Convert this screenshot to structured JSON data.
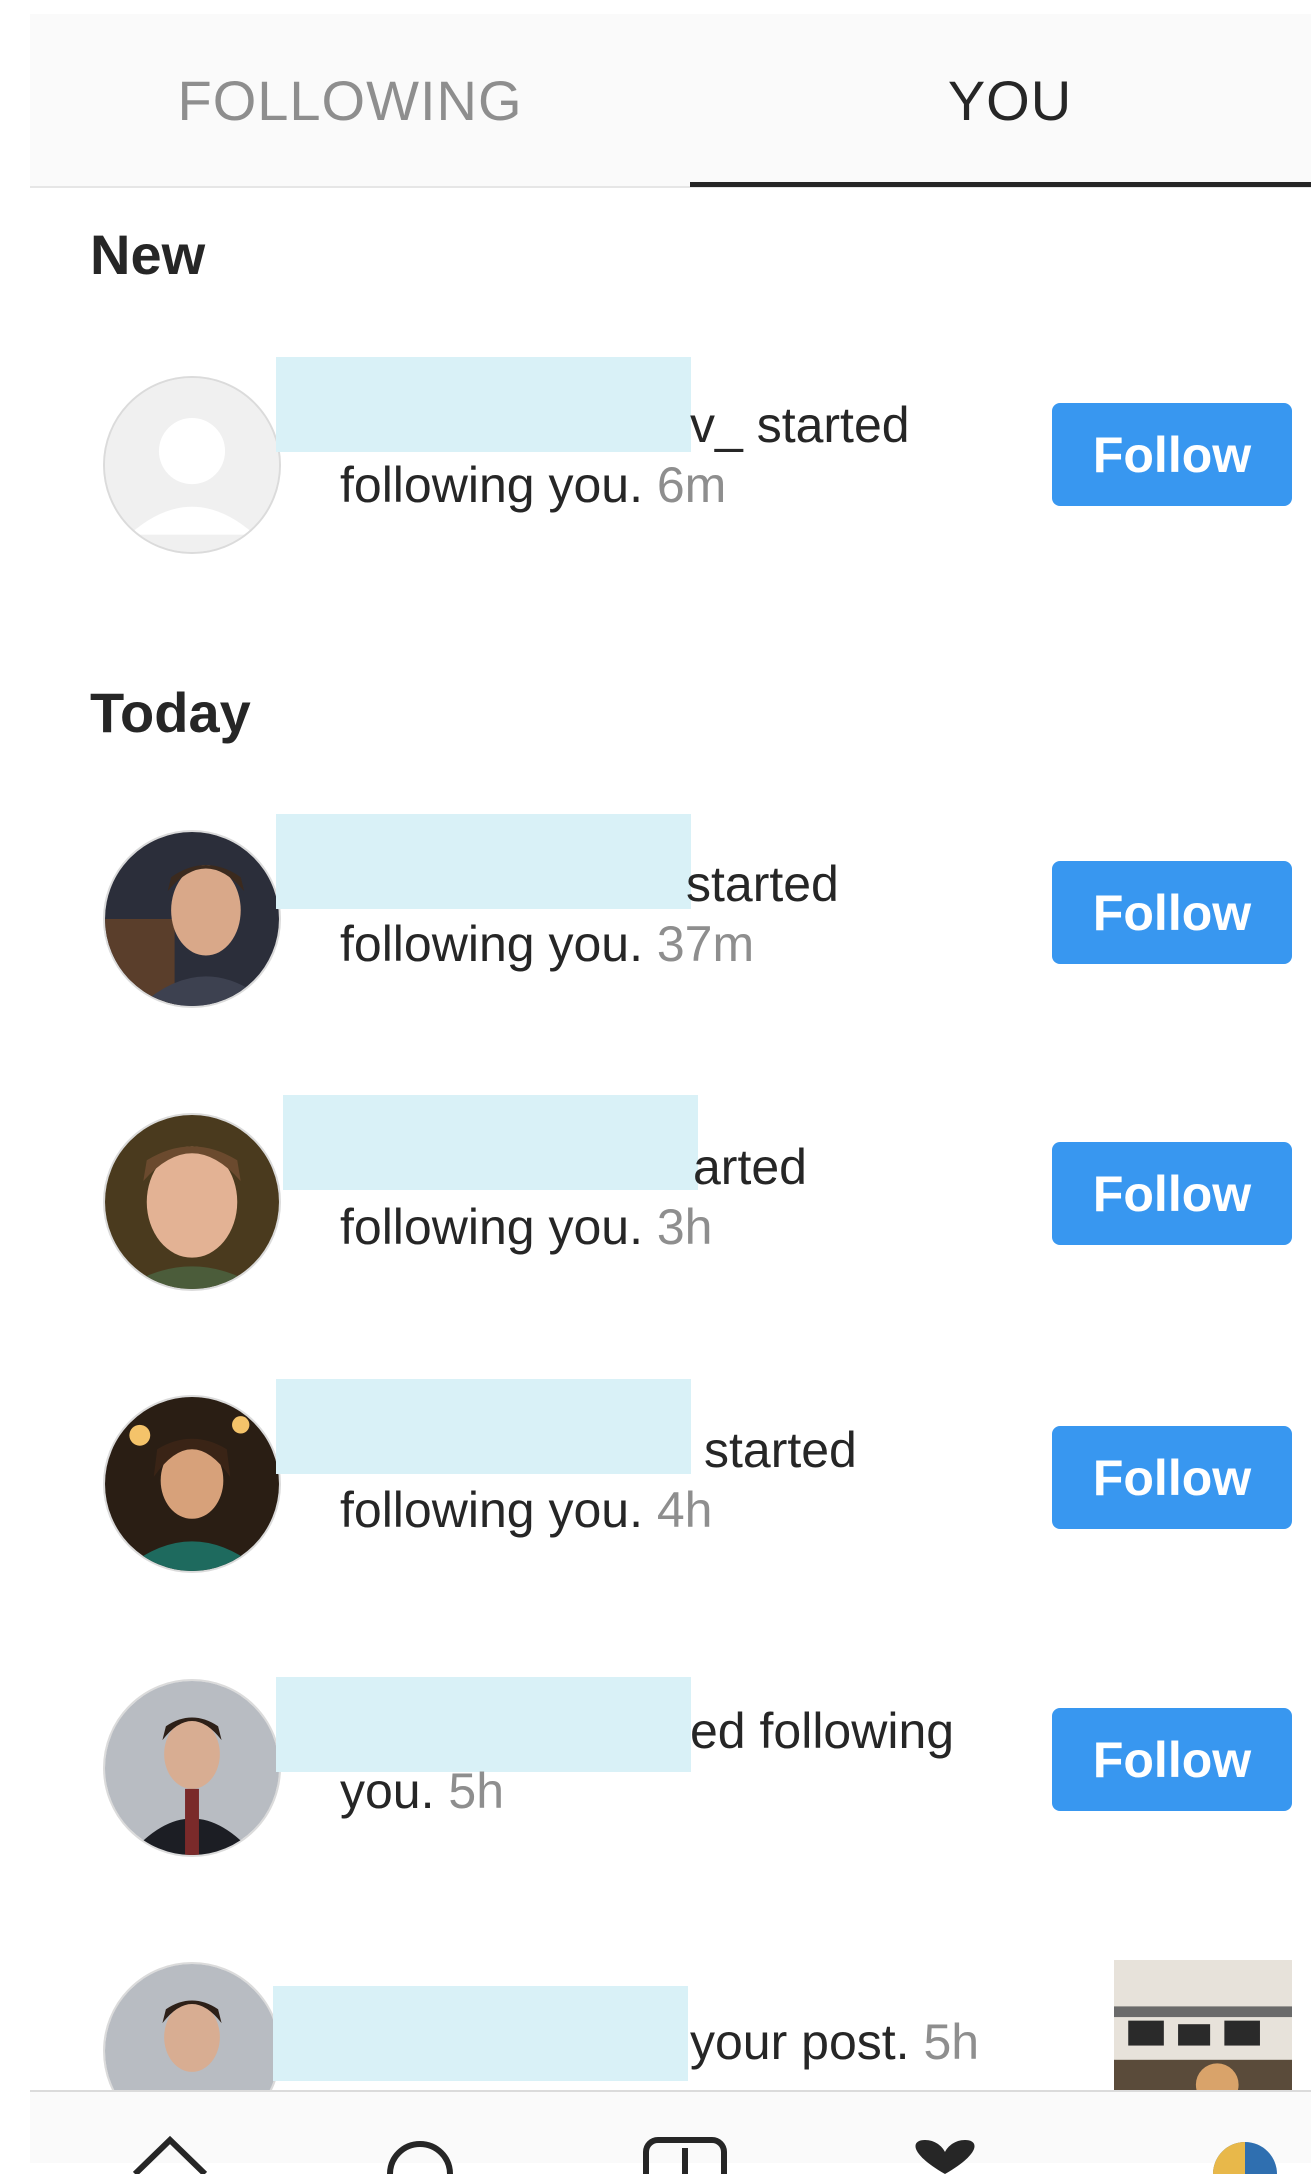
{
  "tabs": {
    "following": "FOLLOWING",
    "you": "YOU"
  },
  "sections": {
    "new": "New",
    "today": "Today"
  },
  "notifications": [
    {
      "line1": "v_ started",
      "line2_text": "following you.",
      "time": "6m",
      "action": "Follow"
    },
    {
      "line1": "started",
      "line2_text": "following you.",
      "time": "37m",
      "action": "Follow"
    },
    {
      "line1": "arted",
      "line2_text": "following you.",
      "time": "3h",
      "action": "Follow"
    },
    {
      "line1": "started",
      "line2_text": "following you.",
      "time": "4h",
      "action": "Follow"
    },
    {
      "line1": "ed following",
      "line2_text": "you.",
      "time": "5h",
      "action": "Follow"
    },
    {
      "line1": "your post.",
      "time": "5h"
    }
  ],
  "colors": {
    "accent": "#3897f0",
    "text": "#262626",
    "muted": "#8e8e8e",
    "redaction": "#d9f1f7"
  },
  "nav_icons": [
    "home-icon",
    "search-icon",
    "add-post-icon",
    "heart-icon",
    "profile-avatar-icon"
  ]
}
